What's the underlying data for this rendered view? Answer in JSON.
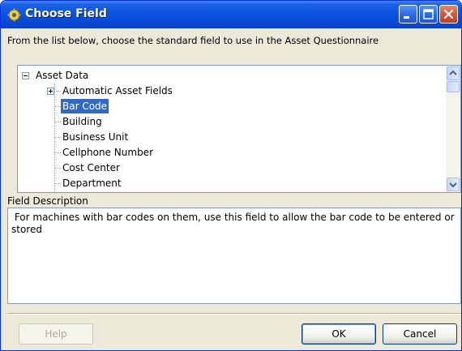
{
  "window": {
    "title": "Choose Field",
    "colors": {
      "titlebar": "#0A55E0",
      "selection": "#316AC5",
      "body": "#ECE9D8"
    }
  },
  "instructions": "From the list below, choose the standard field to use in the Asset Questionnaire",
  "tree": {
    "root": {
      "label": "Asset Data",
      "state": "expanded"
    },
    "items": [
      {
        "label": "Automatic Asset Fields",
        "has_children": true,
        "state": "collapsed"
      },
      {
        "label": "Bar Code",
        "selected": true
      },
      {
        "label": "Building"
      },
      {
        "label": "Business Unit"
      },
      {
        "label": "Cellphone Number"
      },
      {
        "label": "Cost Center"
      },
      {
        "label": "Department"
      }
    ]
  },
  "description": {
    "label": "Field Description",
    "text": " For machines with bar codes on them, use this field to allow the bar code to be entered or stored"
  },
  "buttons": {
    "help": "Help",
    "ok": "OK",
    "cancel": "Cancel"
  },
  "icons": {
    "app": "app-gear-icon",
    "minimize": "minimize-icon",
    "maximize": "maximize-icon",
    "close": "close-icon",
    "scroll_up": "scroll-up-arrow-icon",
    "scroll_down": "scroll-down-arrow-icon"
  }
}
